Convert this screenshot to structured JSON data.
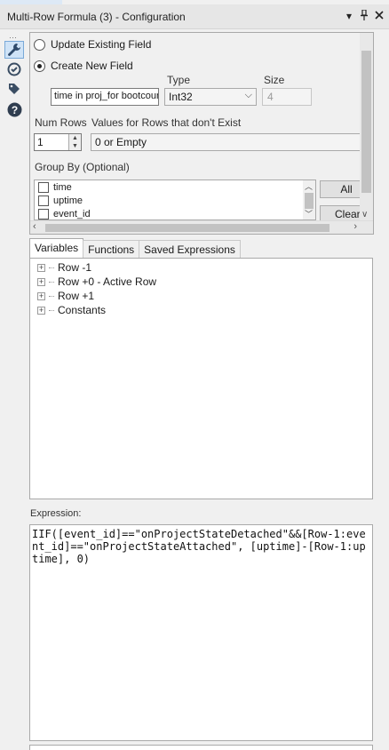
{
  "window": {
    "title": "Multi-Row Formula (3) - Configuration",
    "controls": [
      "▾",
      "📌",
      "✕"
    ]
  },
  "toolbar": {
    "grip": "⋯",
    "buttons": [
      "wrench-icon",
      "target-icon",
      "tag-icon",
      "help-icon"
    ]
  },
  "config": {
    "update_existing_label": "Update Existing Field",
    "create_new_label": "Create New  Field",
    "type_label": "Type",
    "size_label": "Size",
    "new_field_name": "time in proj_for bootcount",
    "type_value": "Int32",
    "size_value": "4",
    "num_rows_label": "Num Rows",
    "num_rows_value": "1",
    "missing_rows_label": "Values for Rows that don't Exist",
    "missing_rows_value": "0 or Empty",
    "group_by_label": "Group By (Optional)",
    "group_by_fields": [
      "time",
      "uptime",
      "event_id"
    ],
    "all_button": "All",
    "clear_button": "Clear"
  },
  "tabs": [
    "Variables",
    "Functions",
    "Saved Expressions"
  ],
  "variables_tree": [
    "Row -1",
    "Row +0 - Active Row",
    "Row +1",
    "Constants"
  ],
  "expression": {
    "label": "Expression:",
    "text": "IIF([event_id]==\"onProjectStateDetached\"&&[Row-1:event_id]==\"onProjectStateAttached\", [uptime]-[Row-1:uptime], 0)"
  }
}
